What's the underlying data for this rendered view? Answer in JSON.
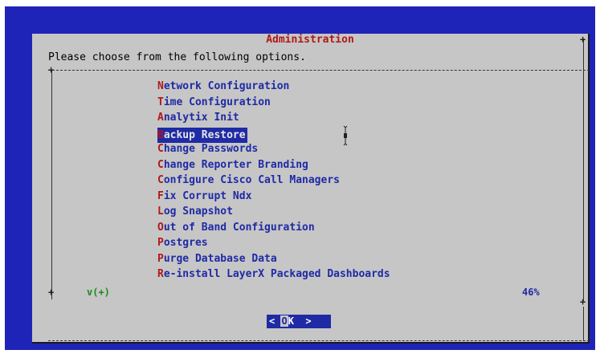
{
  "dialog": {
    "title": "Administration",
    "prompt": "Please choose from the following options."
  },
  "menu": {
    "items": [
      {
        "hot": "N",
        "rest": "etwork Configuration"
      },
      {
        "hot": "T",
        "rest": "ime Configuration"
      },
      {
        "hot": "A",
        "rest": "nalytix Init"
      },
      {
        "hot": "B",
        "rest": "ackup Restore"
      },
      {
        "hot": "C",
        "rest": "hange Passwords"
      },
      {
        "hot": "C",
        "rest": "hange Reporter Branding"
      },
      {
        "hot": "C",
        "rest": "onfigure Cisco Call Managers"
      },
      {
        "hot": "F",
        "rest": "ix Corrupt Ndx"
      },
      {
        "hot": "L",
        "rest": "og Snapshot"
      },
      {
        "hot": "O",
        "rest": "ut of Band Configuration"
      },
      {
        "hot": "P",
        "rest": "ostgres"
      },
      {
        "hot": "P",
        "rest": "urge Database Data"
      },
      {
        "hot": "R",
        "rest": "e-install LayerX Packaged Dashboards"
      }
    ],
    "selected_index": 3
  },
  "scroll": {
    "indicator": "v(+)",
    "percent": "46%"
  },
  "button": {
    "left": "< ",
    "hot": "O",
    "rest": "K",
    "right": "  >"
  },
  "colors": {
    "background": "#1f24b8",
    "dialog": "#c6c6c6",
    "hotkey": "#b01818",
    "item_text": "#1f2aa5",
    "indicator": "#1b8a1b"
  }
}
